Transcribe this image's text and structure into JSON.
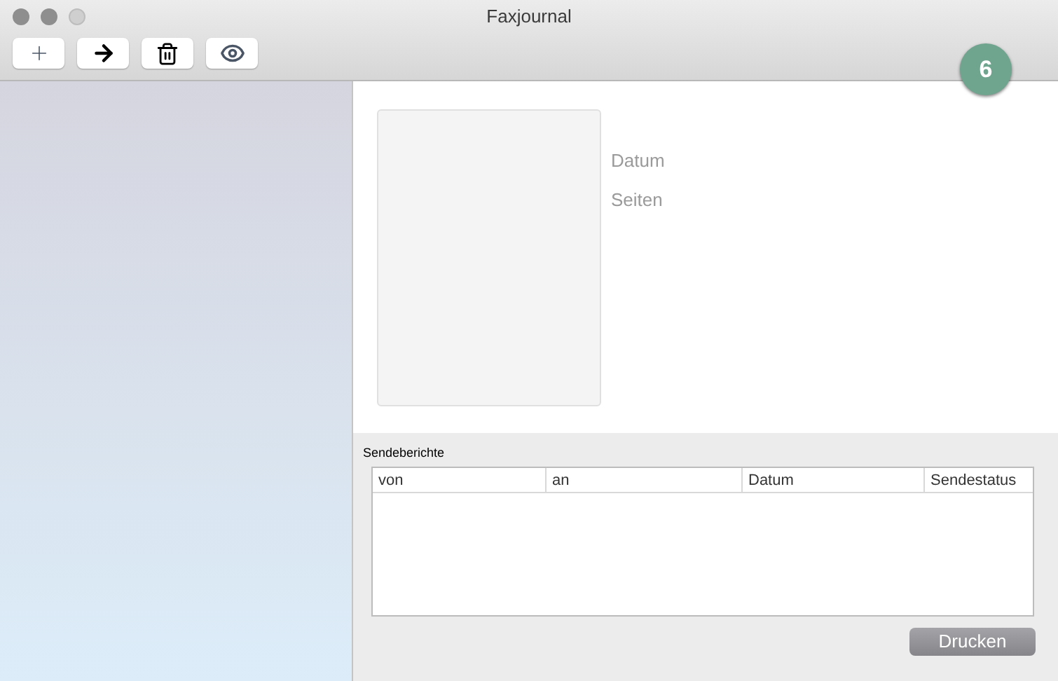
{
  "window": {
    "title": "Faxjournal"
  },
  "toolbar": [
    {
      "kind": "add"
    },
    {
      "kind": "forward"
    },
    {
      "kind": "delete"
    },
    {
      "kind": "preview"
    }
  ],
  "badge": "6",
  "preview": {
    "fields": [
      "Datum",
      "Seiten"
    ]
  },
  "reports": {
    "title": "Sendeberichte",
    "columns": [
      "von",
      "an",
      "Datum",
      "Sendestatus"
    ]
  },
  "print_button": "Drucken"
}
